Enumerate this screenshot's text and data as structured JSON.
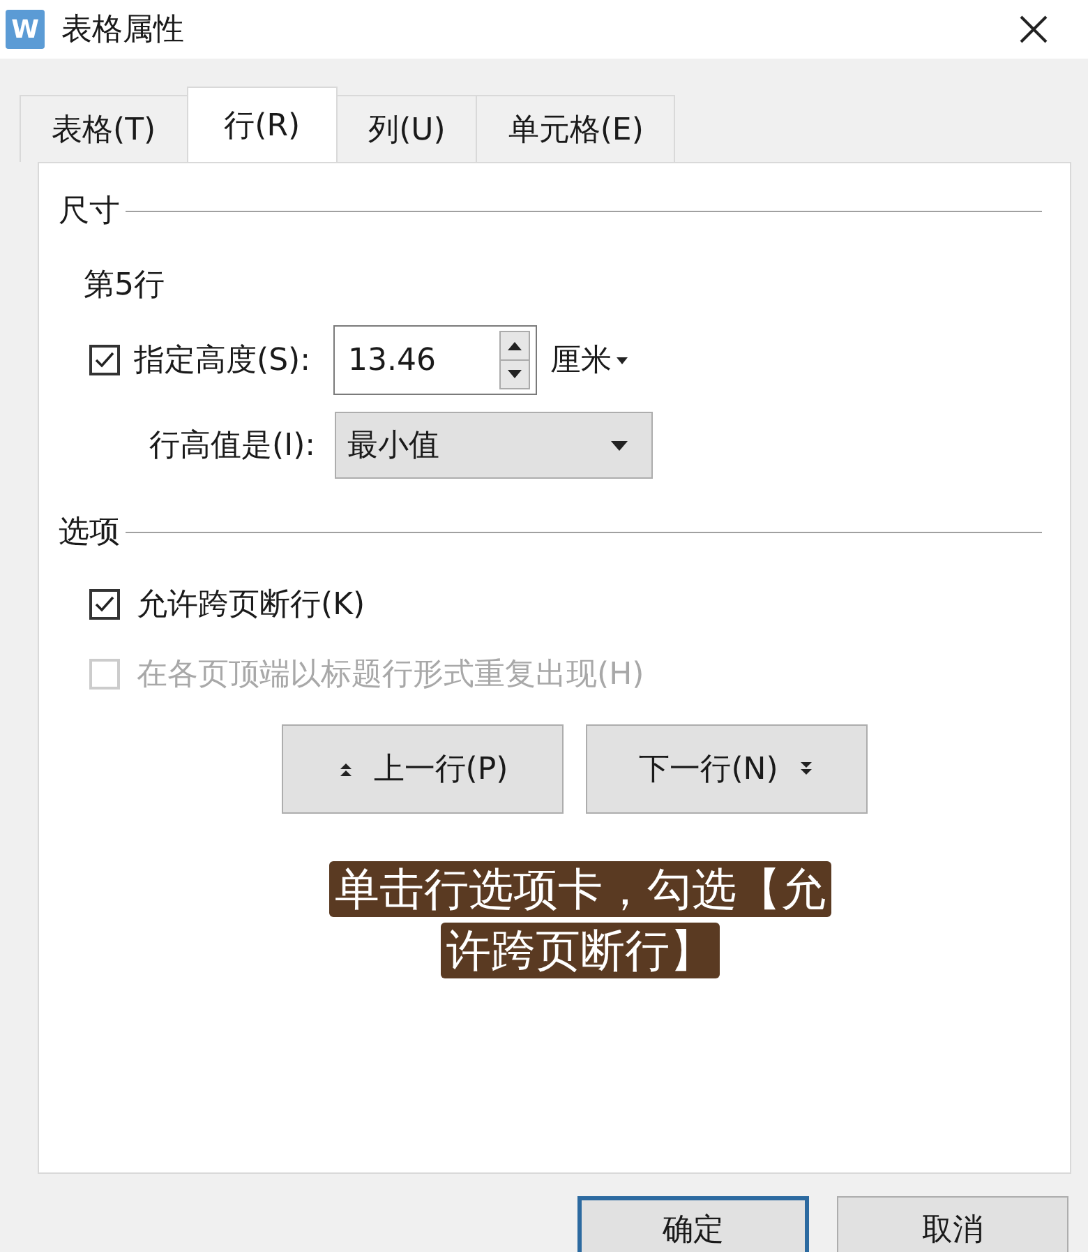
{
  "window": {
    "title": "表格属性",
    "app_icon": "W"
  },
  "tabs": [
    {
      "label": "表格(T)",
      "selected": false
    },
    {
      "label": "行(R)",
      "selected": true
    },
    {
      "label": "列(U)",
      "selected": false
    },
    {
      "label": "单元格(E)",
      "selected": false
    }
  ],
  "size_section": {
    "title": "尺寸",
    "row_label": "第5行",
    "height_checkbox": {
      "label": "指定高度(S):",
      "checked": true
    },
    "height_value": "13.46",
    "unit": "厘米",
    "mode_label": "行高值是(I):",
    "mode_value": "最小值"
  },
  "options_section": {
    "title": "选项",
    "checkboxes": [
      {
        "label": "允许跨页断行(K)",
        "checked": true,
        "disabled": false
      },
      {
        "label": "在各页顶端以标题行形式重复出现(H)",
        "checked": false,
        "disabled": true
      }
    ]
  },
  "nav_buttons": [
    {
      "label": "上一行(P)",
      "kind": "prev"
    },
    {
      "label": "下一行(N)",
      "kind": "next"
    }
  ],
  "caption": [
    "单击行选项卡，勾选【允",
    "许跨页断行】"
  ],
  "buttons": [
    {
      "label": "确定",
      "default": true
    },
    {
      "label": "取消",
      "default": false
    }
  ]
}
